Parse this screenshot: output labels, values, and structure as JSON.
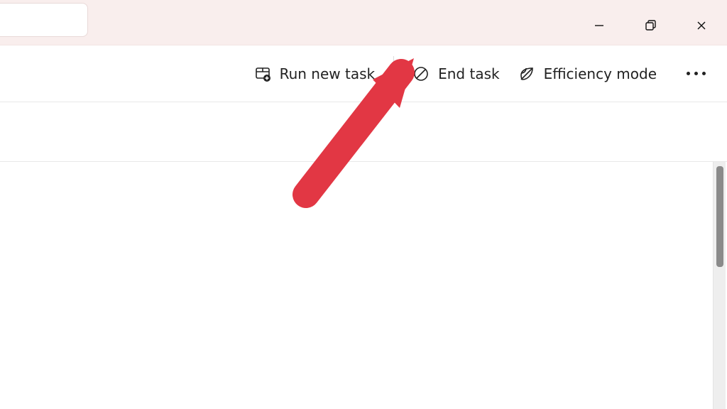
{
  "titlebar": {
    "window_controls": {
      "minimize": "minimize",
      "maximize": "restore",
      "close": "close"
    }
  },
  "toolbar": {
    "run_new_task_label": "Run new task",
    "end_task_label": "End task",
    "efficiency_mode_label": "Efficiency mode"
  },
  "annotation": {
    "color": "#e23744",
    "target": "end-task-button"
  }
}
